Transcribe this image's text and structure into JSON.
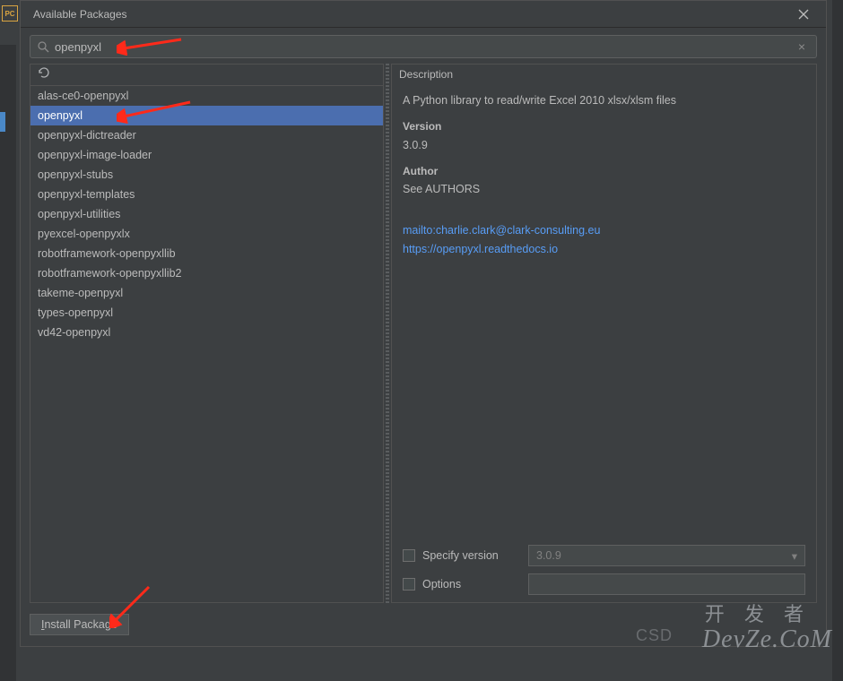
{
  "dialog": {
    "title": "Available Packages",
    "pc_badge": "PC"
  },
  "search": {
    "value": "openpyxl"
  },
  "packages": [
    {
      "name": "alas-ce0-openpyxl",
      "selected": false
    },
    {
      "name": "openpyxl",
      "selected": true
    },
    {
      "name": "openpyxl-dictreader",
      "selected": false
    },
    {
      "name": "openpyxl-image-loader",
      "selected": false
    },
    {
      "name": "openpyxl-stubs",
      "selected": false
    },
    {
      "name": "openpyxl-templates",
      "selected": false
    },
    {
      "name": "openpyxl-utilities",
      "selected": false
    },
    {
      "name": "pyexcel-openpyxlx",
      "selected": false
    },
    {
      "name": "robotframework-openpyxllib",
      "selected": false
    },
    {
      "name": "robotframework-openpyxllib2",
      "selected": false
    },
    {
      "name": "takeme-openpyxl",
      "selected": false
    },
    {
      "name": "types-openpyxl",
      "selected": false
    },
    {
      "name": "vd42-openpyxl",
      "selected": false
    }
  ],
  "description": {
    "header": "Description",
    "summary": "A Python library to read/write Excel 2010 xlsx/xlsm files",
    "version_label": "Version",
    "version": "3.0.9",
    "author_label": "Author",
    "author": "See AUTHORS",
    "links": [
      "mailto:charlie.clark@clark-consulting.eu",
      "https://openpyxl.readthedocs.io"
    ]
  },
  "options": {
    "specify_version_label": "Specify version",
    "specify_version_value": "3.0.9",
    "options_label": "Options",
    "options_value": ""
  },
  "footer": {
    "install_label_prefix": "I",
    "install_label_rest": "nstall Package"
  },
  "watermark": {
    "csd": "CSD",
    "main": "DevZe.CoM",
    "cn": "开 发 者"
  }
}
